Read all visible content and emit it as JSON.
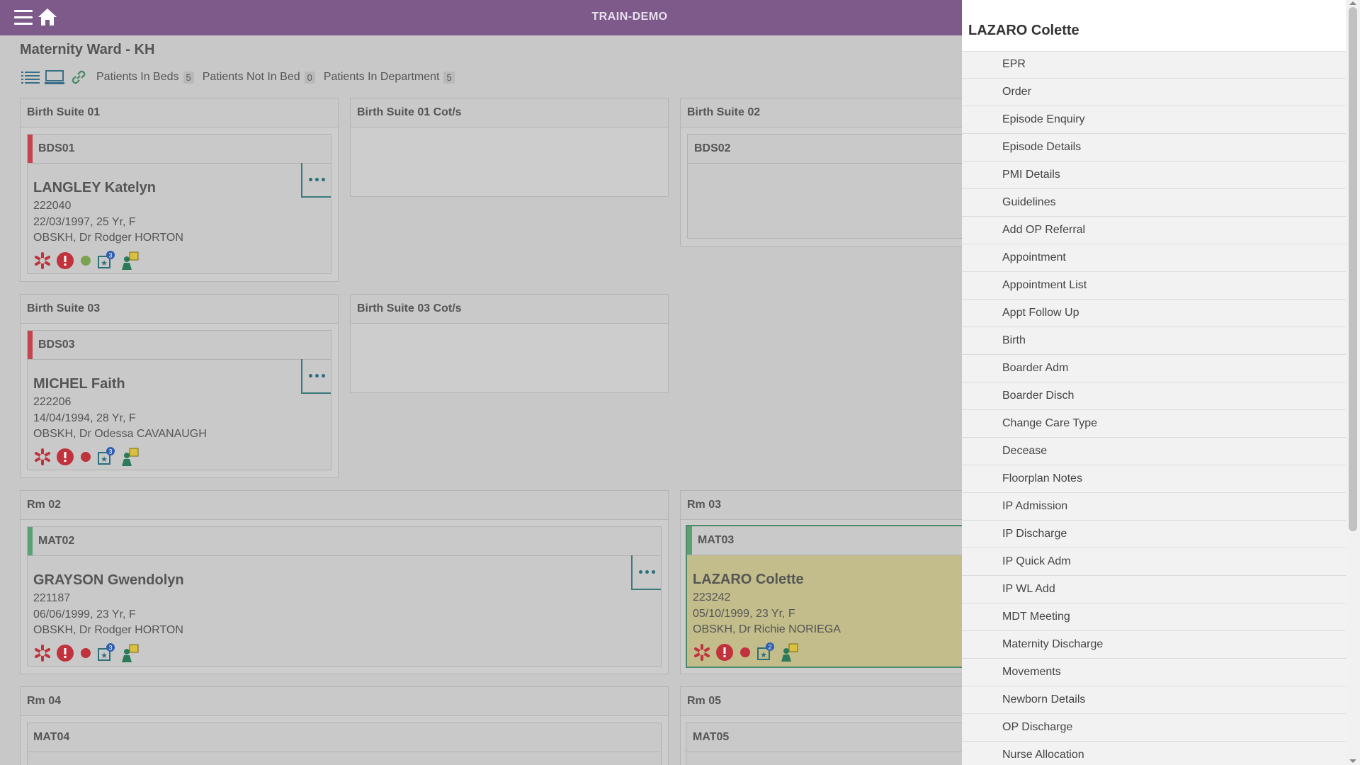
{
  "app": {
    "title": "TRAIN-DEMO"
  },
  "ward": {
    "title": "Maternity Ward - KH",
    "filters": [
      {
        "label": "Patients In Beds",
        "count": "5"
      },
      {
        "label": "Patients Not In Bed",
        "count": "0"
      },
      {
        "label": "Patients In Department",
        "count": "5"
      }
    ]
  },
  "rooms": {
    "bs01": {
      "title": "Birth Suite 01"
    },
    "bs01cot": {
      "title": "Birth Suite 01 Cot/s"
    },
    "bs02": {
      "title": "Birth Suite 02"
    },
    "bs03": {
      "title": "Birth Suite 03"
    },
    "bs03cot": {
      "title": "Birth Suite 03 Cot/s"
    },
    "rm02": {
      "title": "Rm 02"
    },
    "rm03": {
      "title": "Rm 03"
    },
    "rm04": {
      "title": "Rm 04"
    },
    "rm05": {
      "title": "Rm 05"
    }
  },
  "beds": {
    "bds01": {
      "code": "BDS01",
      "name": "LANGLEY Katelyn",
      "mrn": "222040",
      "dob": "22/03/1997, 25 Yr, F",
      "consultant": "OBSKH, Dr Rodger HORTON",
      "alert_count": "3"
    },
    "bds02": {
      "code": "BDS02"
    },
    "bds03": {
      "code": "BDS03",
      "name": "MICHEL Faith",
      "mrn": "222206",
      "dob": "14/04/1994, 28 Yr, F",
      "consultant": "OBSKH, Dr Odessa CAVANAUGH",
      "alert_count": "3"
    },
    "mat02": {
      "code": "MAT02",
      "name": "GRAYSON Gwendolyn",
      "mrn": "221187",
      "dob": "06/06/1999, 23 Yr, F",
      "consultant": "OBSKH, Dr Rodger HORTON",
      "alert_count": "3"
    },
    "mat03": {
      "code": "MAT03",
      "name": "LAZARO Colette",
      "mrn": "223242",
      "dob": "05/10/1999, 23 Yr, F",
      "consultant": "OBSKH, Dr Richie NORIEGA",
      "alert_count": "2"
    },
    "mat04": {
      "code": "MAT04"
    },
    "mat05": {
      "code": "MAT05"
    }
  },
  "panel": {
    "title": "LAZARO Colette",
    "items": [
      "EPR",
      "Order",
      "Episode Enquiry",
      "Episode Details",
      "PMI Details",
      "Guidelines",
      "Add OP Referral",
      "Appointment",
      "Appointment List",
      "Appt Follow Up",
      "Birth",
      "Boarder Adm",
      "Boarder Disch",
      "Change Care Type",
      "Decease",
      "Floorplan Notes",
      "IP Admission",
      "IP Discharge",
      "IP Quick Adm",
      "IP WL Add",
      "MDT Meeting",
      "Maternity Discharge",
      "Movements",
      "Newborn Details",
      "OP Discharge",
      "Nurse Allocation"
    ]
  },
  "colors": {
    "topbar": "#7e5a8b",
    "flag_red": "#c24550",
    "flag_green": "#5aa173",
    "selected_bg": "#c2bd8a",
    "alert_red": "#c0323c"
  },
  "icons": [
    "menu-icon",
    "home-icon",
    "list-view-icon",
    "screen-view-icon",
    "link-icon",
    "medical-asterisk-icon",
    "alert-exclamation-icon",
    "status-dot-icon",
    "task-star-icon",
    "person-card-icon",
    "more-icon"
  ]
}
